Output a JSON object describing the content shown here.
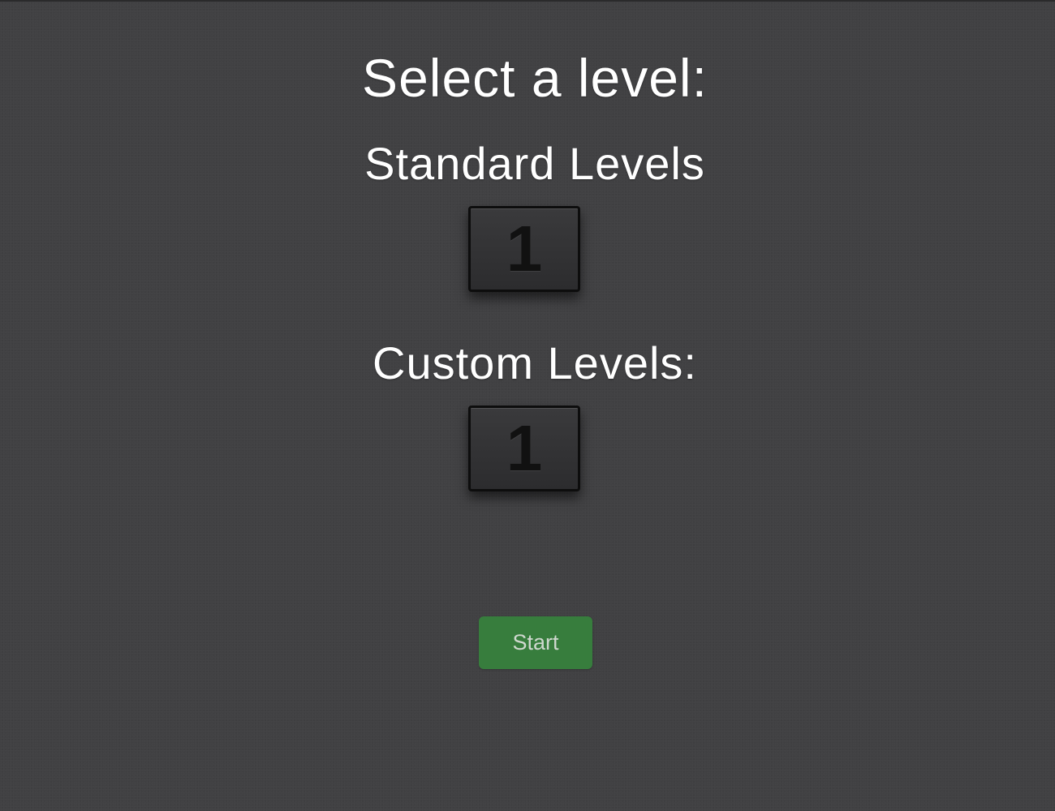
{
  "screen": {
    "title": "Select a level:"
  },
  "standard_levels": {
    "heading": "Standard Levels",
    "levels": [
      {
        "label": "1"
      }
    ]
  },
  "custom_levels": {
    "heading": "Custom Levels:",
    "levels": [
      {
        "label": "1"
      }
    ]
  },
  "actions": {
    "start_label": "Start"
  },
  "colors": {
    "background": "#414143",
    "start_button": "#377d3d",
    "tile_border": "#0d0d0d",
    "text": "#ffffff"
  }
}
